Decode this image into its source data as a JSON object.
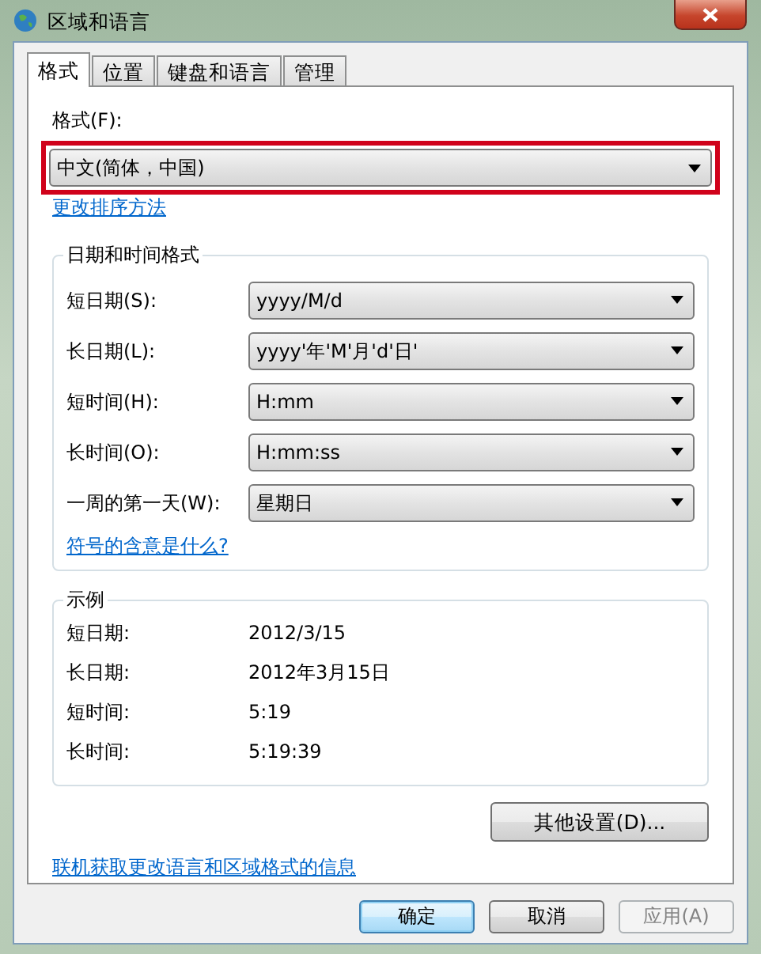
{
  "window": {
    "title": "区域和语言"
  },
  "tabs": [
    {
      "label": "格式",
      "selected": true
    },
    {
      "label": "位置",
      "selected": false
    },
    {
      "label": "键盘和语言",
      "selected": false
    },
    {
      "label": "管理",
      "selected": false
    }
  ],
  "format": {
    "label": "格式(F):",
    "value": "中文(简体，中国)",
    "highlighted": true
  },
  "sort_link": "更改排序方法",
  "date_time_formats": {
    "title": "日期和时间格式",
    "rows": [
      {
        "label": "短日期(S):",
        "value": "yyyy/M/d"
      },
      {
        "label": "长日期(L):",
        "value": "yyyy'年'M'月'd'日'"
      },
      {
        "label": "短时间(H):",
        "value": "H:mm"
      },
      {
        "label": "长时间(O):",
        "value": "H:mm:ss"
      },
      {
        "label": "一周的第一天(W):",
        "value": "星期日"
      }
    ],
    "link": "符号的含意是什么?"
  },
  "examples": {
    "title": "示例",
    "rows": [
      {
        "label": "短日期:",
        "value": "2012/3/15"
      },
      {
        "label": "长日期:",
        "value": "2012年3月15日"
      },
      {
        "label": "短时间:",
        "value": "5:19"
      },
      {
        "label": "长时间:",
        "value": "5:19:39"
      }
    ]
  },
  "other_settings_button": "其他设置(D)...",
  "online_link": "联机获取更改语言和区域格式的信息",
  "buttons": [
    {
      "label": "确定",
      "default": true,
      "disabled": false
    },
    {
      "label": "取消",
      "default": false,
      "disabled": false
    },
    {
      "label": "应用(A)",
      "default": false,
      "disabled": true
    }
  ]
}
